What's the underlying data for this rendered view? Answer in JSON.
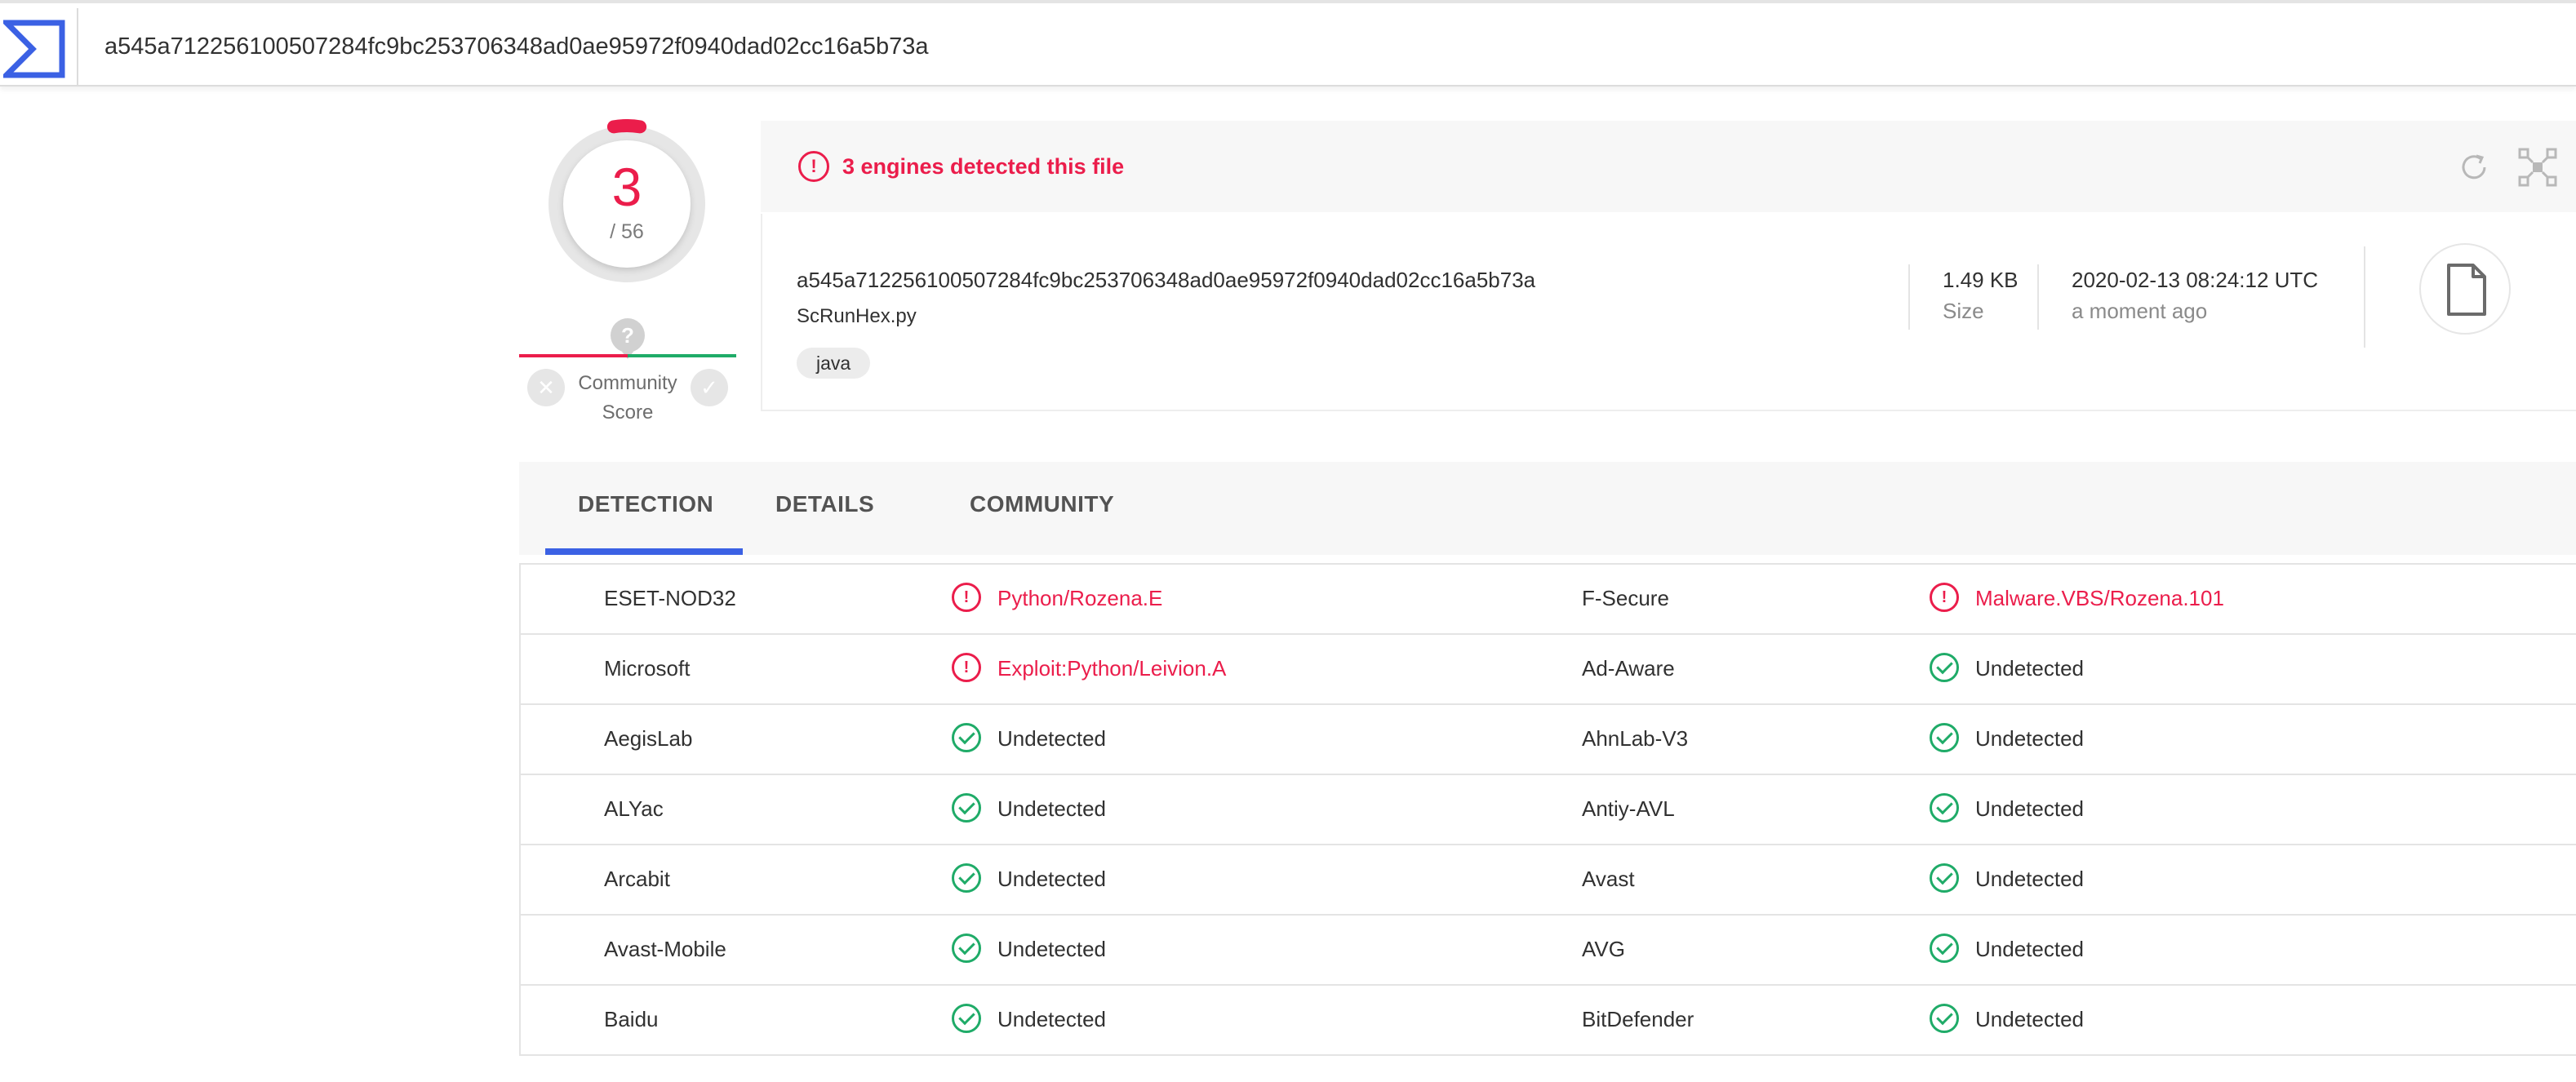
{
  "search": {
    "value": "a545a712256100507284fc9bc253706348ad0ae95972f0940dad02cc16a5b73a"
  },
  "score": {
    "detections": "3",
    "total": "/ 56",
    "detected_fraction": 0.0536
  },
  "community_score": {
    "label": "Community Score",
    "question_glyph": "?",
    "downvote_glyph": "✕",
    "upvote_glyph": "✓"
  },
  "detection_summary": {
    "title": "3 engines detected this file",
    "icon": "alert-circle-icon"
  },
  "file": {
    "hash": "a545a712256100507284fc9bc253706348ad0ae95972f0940dad02cc16a5b73a",
    "name": "ScRunHex.py",
    "tags": [
      "java"
    ],
    "size_value": "1.49 KB",
    "size_label": "Size",
    "date_value": "2020-02-13 08:24:12 UTC",
    "date_label": "a moment ago",
    "type_icon": "file-icon"
  },
  "tabs": [
    {
      "label": "DETECTION",
      "active": true
    },
    {
      "label": "DETAILS",
      "active": false
    },
    {
      "label": "COMMUNITY",
      "active": false
    }
  ],
  "colors": {
    "malicious": "#eb1d4b",
    "clean": "#1fab68",
    "accent": "#3b61e4"
  },
  "detections": [
    {
      "engine_left": "ESET-NOD32",
      "result_left": "Python/Rozena.E",
      "status_left": "malicious",
      "engine_right": "F-Secure",
      "result_right": "Malware.VBS/Rozena.101",
      "status_right": "malicious"
    },
    {
      "engine_left": "Microsoft",
      "result_left": "Exploit:Python/Leivion.A",
      "status_left": "malicious",
      "engine_right": "Ad-Aware",
      "result_right": "Undetected",
      "status_right": "clean"
    },
    {
      "engine_left": "AegisLab",
      "result_left": "Undetected",
      "status_left": "clean",
      "engine_right": "AhnLab-V3",
      "result_right": "Undetected",
      "status_right": "clean"
    },
    {
      "engine_left": "ALYac",
      "result_left": "Undetected",
      "status_left": "clean",
      "engine_right": "Antiy-AVL",
      "result_right": "Undetected",
      "status_right": "clean"
    },
    {
      "engine_left": "Arcabit",
      "result_left": "Undetected",
      "status_left": "clean",
      "engine_right": "Avast",
      "result_right": "Undetected",
      "status_right": "clean"
    },
    {
      "engine_left": "Avast-Mobile",
      "result_left": "Undetected",
      "status_left": "clean",
      "engine_right": "AVG",
      "result_right": "Undetected",
      "status_right": "clean"
    },
    {
      "engine_left": "Baidu",
      "result_left": "Undetected",
      "status_left": "clean",
      "engine_right": "BitDefender",
      "result_right": "Undetected",
      "status_right": "clean"
    }
  ]
}
